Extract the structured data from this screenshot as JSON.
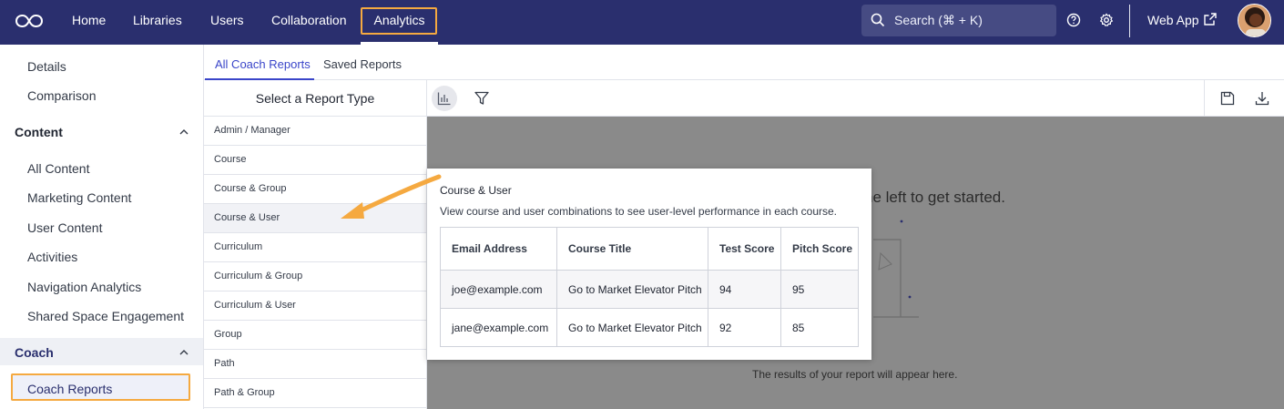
{
  "header": {
    "nav": [
      {
        "label": "Home"
      },
      {
        "label": "Libraries"
      },
      {
        "label": "Users"
      },
      {
        "label": "Collaboration"
      },
      {
        "label": "Analytics"
      }
    ],
    "search_placeholder": "Search (⌘ + K)",
    "web_app_label": "Web App"
  },
  "sidebar": {
    "top_items": [
      "Details",
      "Comparison"
    ],
    "content_section": "Content",
    "content_items": [
      "All Content",
      "Marketing Content",
      "User Content",
      "Activities",
      "Navigation Analytics",
      "Shared Space Engagement"
    ],
    "coach_section": "Coach",
    "coach_items": [
      "Coach Reports"
    ]
  },
  "tabs": [
    "All Coach Reports",
    "Saved Reports"
  ],
  "report_type_header": "Select a Report Type",
  "report_types": [
    "Admin / Manager",
    "Course",
    "Course & Group",
    "Course & User",
    "Curriculum",
    "Curriculum & Group",
    "Curriculum & User",
    "Group",
    "Path",
    "Path & Group"
  ],
  "results": {
    "hint_fragment": "he left to get started.",
    "empty_text": "The results of your report will appear here."
  },
  "tooltip": {
    "title": "Course & User",
    "description": "View course and user combinations to see user-level performance in each course.",
    "columns": [
      "Email Address",
      "Course Title",
      "Test Score",
      "Pitch Score"
    ],
    "rows": [
      [
        "joe@example.com",
        "Go to Market Elevator Pitch",
        "94",
        "95"
      ],
      [
        "jane@example.com",
        "Go to Market Elevator Pitch",
        "92",
        "85"
      ]
    ]
  },
  "colors": {
    "topbar": "#2a2f6e",
    "accent": "#3a45c9",
    "highlight": "#f5a940"
  }
}
